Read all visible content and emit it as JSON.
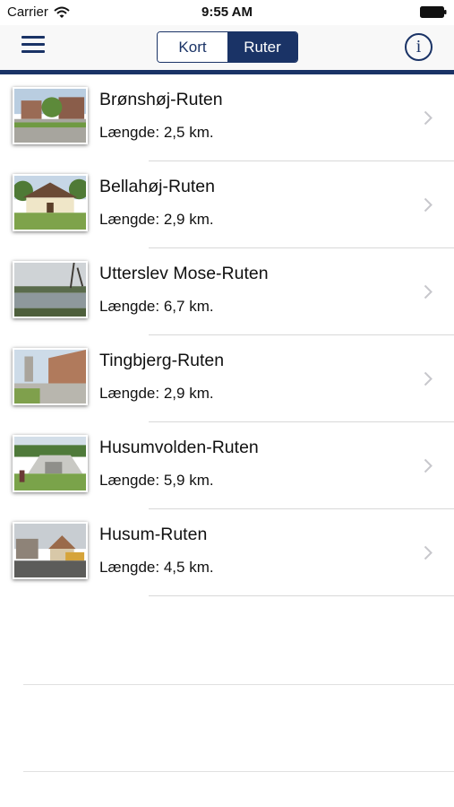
{
  "status_bar": {
    "carrier": "Carrier",
    "time": "9:55 AM"
  },
  "nav": {
    "segments": [
      "Kort",
      "Ruter"
    ],
    "active_segment": "Ruter",
    "menu_icon": "hamburger-menu-icon",
    "info_icon": "info-icon"
  },
  "colors": {
    "accent": "#1a3366",
    "separator": "#d8d8d8",
    "chevron": "#c7c7cc"
  },
  "routes": [
    {
      "title": "Brønshøj-Ruten",
      "length": "Længde: 2,5 km."
    },
    {
      "title": "Bellahøj-Ruten",
      "length": "Længde: 2,9 km."
    },
    {
      "title": "Utterslev Mose-Ruten",
      "length": "Længde: 6,7 km."
    },
    {
      "title": "Tingbjerg-Ruten",
      "length": "Længde: 2,9 km."
    },
    {
      "title": "Husumvolden-Ruten",
      "length": "Længde: 5,9 km."
    },
    {
      "title": "Husum-Ruten",
      "length": "Længde: 4,5 km."
    }
  ]
}
